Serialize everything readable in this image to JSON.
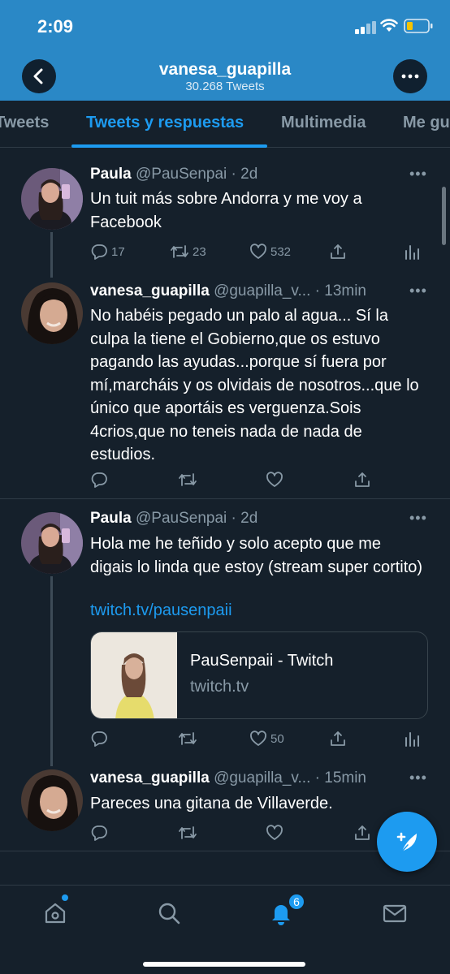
{
  "status_bar": {
    "time": "2:09"
  },
  "header": {
    "profile_name": "vanesa_guapilla",
    "tweet_count": "30.268 Tweets"
  },
  "tabs": [
    {
      "label": "Tweets"
    },
    {
      "label": "Tweets y respuestas",
      "active": true
    },
    {
      "label": "Multimedia"
    },
    {
      "label": "Me gu"
    }
  ],
  "tweets": [
    {
      "name": "Paula",
      "handle": "@PauSenpai",
      "time": "· 2d",
      "text": "Un tuit más sobre Andorra y me voy a Facebook",
      "replies": "17",
      "retweets": "23",
      "likes": "532"
    },
    {
      "name": "vanesa_guapilla",
      "handle": "@guapilla_v...",
      "time": "· 13min",
      "text": "No habéis pegado un palo al agua... Sí la culpa la tiene el Gobierno,que os estuvo pagando las ayudas...porque sí fuera por mí,marcháis y os olvidais de nosotros...que lo único que aportáis es verguenza.Sois 4crios,que no teneis nada de nada de estudios."
    },
    {
      "name": "Paula",
      "handle": "@PauSenpai",
      "time": "· 2d",
      "text": "Hola me he teñido y solo acepto que me digais lo linda que estoy (stream super cortito)",
      "link": "twitch.tv/pausenpaii",
      "card": {
        "title": "PauSenpaii - Twitch",
        "url": "twitch.tv"
      },
      "likes": "50"
    },
    {
      "name": "vanesa_guapilla",
      "handle": "@guapilla_v...",
      "time": "· 15min",
      "text": "Pareces una gitana de Villaverde."
    }
  ],
  "bottom_nav": {
    "notification_count": "6"
  },
  "colors": {
    "header": "#2a88c6",
    "background": "#15202b",
    "accent": "#1d9bf0",
    "muted": "#8899a6"
  }
}
